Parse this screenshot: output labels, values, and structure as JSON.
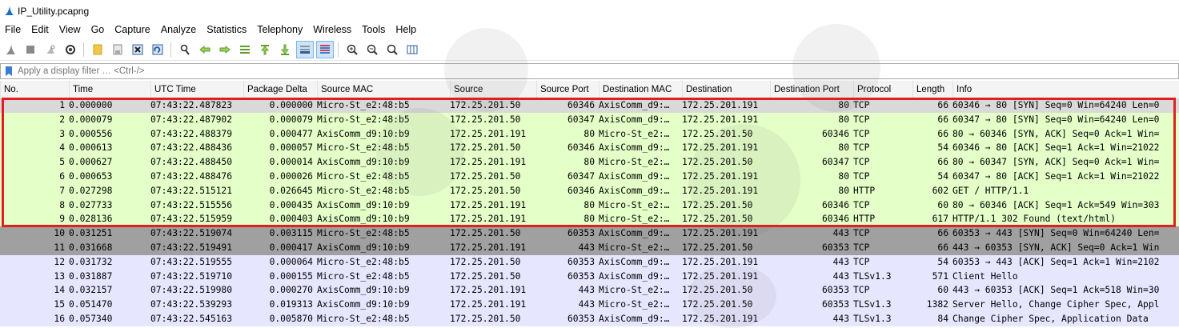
{
  "window": {
    "title": "IP_Utility.pcapng"
  },
  "menu": [
    "File",
    "Edit",
    "View",
    "Go",
    "Capture",
    "Analyze",
    "Statistics",
    "Telephony",
    "Wireless",
    "Tools",
    "Help"
  ],
  "toolbar_icons": [
    "shark-fin-start-icon",
    "stop-icon",
    "restart-icon",
    "capture-options-icon",
    "open-file-icon",
    "save-file-icon",
    "close-file-icon",
    "reload-file-icon",
    "find-packet-icon",
    "go-back-icon",
    "go-forward-icon",
    "go-to-packet-icon",
    "go-first-icon",
    "go-last-icon",
    "autoscroll-icon",
    "colorize-icon",
    "zoom-in-icon",
    "zoom-out-icon",
    "zoom-normal-icon",
    "resize-columns-icon"
  ],
  "filter": {
    "placeholder": "Apply a display filter … <Ctrl-/>"
  },
  "columns": [
    "No.",
    "Time",
    "UTC Time",
    "Package Delta",
    "Source MAC",
    "Source",
    "Source Port",
    "Destination MAC",
    "Destination",
    "Destination Port",
    "Protocol",
    "Length",
    "Info"
  ],
  "colors": {
    "tcp_green": "#e4ffc7",
    "selected_bg": "#d9d9d9",
    "dark_row": "#a0a0a0",
    "tls_lavender": "#e7e6ff",
    "highlight_box": "#e02020"
  },
  "rows": [
    {
      "no": "1",
      "time": "0.000000",
      "utc": "07:43:22.487823",
      "delta": "0.000000",
      "smac": "Micro-St_e2:48:b5",
      "src": "172.25.201.50",
      "sport": "60346",
      "dmac": "AxisComm_d9:…",
      "dst": "172.25.201.191",
      "dport": "80",
      "proto": "TCP",
      "len": "66",
      "info": "60346 → 80 [SYN] Seq=0 Win=64240 Len=0",
      "style": "selected"
    },
    {
      "no": "2",
      "time": "0.000079",
      "utc": "07:43:22.487902",
      "delta": "0.000079",
      "smac": "Micro-St_e2:48:b5",
      "src": "172.25.201.50",
      "sport": "60347",
      "dmac": "AxisComm_d9:…",
      "dst": "172.25.201.191",
      "dport": "80",
      "proto": "TCP",
      "len": "66",
      "info": "60347 → 80 [SYN] Seq=0 Win=64240 Len=0",
      "style": "green"
    },
    {
      "no": "3",
      "time": "0.000556",
      "utc": "07:43:22.488379",
      "delta": "0.000477",
      "smac": "AxisComm_d9:10:b9",
      "src": "172.25.201.191",
      "sport": "80",
      "dmac": "Micro-St_e2:…",
      "dst": "172.25.201.50",
      "dport": "60346",
      "proto": "TCP",
      "len": "66",
      "info": "80 → 60346 [SYN, ACK] Seq=0 Ack=1 Win=",
      "style": "green"
    },
    {
      "no": "4",
      "time": "0.000613",
      "utc": "07:43:22.488436",
      "delta": "0.000057",
      "smac": "Micro-St_e2:48:b5",
      "src": "172.25.201.50",
      "sport": "60346",
      "dmac": "AxisComm_d9:…",
      "dst": "172.25.201.191",
      "dport": "80",
      "proto": "TCP",
      "len": "54",
      "info": "60346 → 80 [ACK] Seq=1 Ack=1 Win=21022",
      "style": "green"
    },
    {
      "no": "5",
      "time": "0.000627",
      "utc": "07:43:22.488450",
      "delta": "0.000014",
      "smac": "AxisComm_d9:10:b9",
      "src": "172.25.201.191",
      "sport": "80",
      "dmac": "Micro-St_e2:…",
      "dst": "172.25.201.50",
      "dport": "60347",
      "proto": "TCP",
      "len": "66",
      "info": "80 → 60347 [SYN, ACK] Seq=0 Ack=1 Win=",
      "style": "green"
    },
    {
      "no": "6",
      "time": "0.000653",
      "utc": "07:43:22.488476",
      "delta": "0.000026",
      "smac": "Micro-St_e2:48:b5",
      "src": "172.25.201.50",
      "sport": "60347",
      "dmac": "AxisComm_d9:…",
      "dst": "172.25.201.191",
      "dport": "80",
      "proto": "TCP",
      "len": "54",
      "info": "60347 → 80 [ACK] Seq=1 Ack=1 Win=21022",
      "style": "green"
    },
    {
      "no": "7",
      "time": "0.027298",
      "utc": "07:43:22.515121",
      "delta": "0.026645",
      "smac": "Micro-St_e2:48:b5",
      "src": "172.25.201.50",
      "sport": "60346",
      "dmac": "AxisComm_d9:…",
      "dst": "172.25.201.191",
      "dport": "80",
      "proto": "HTTP",
      "len": "602",
      "info": "GET / HTTP/1.1",
      "style": "green"
    },
    {
      "no": "8",
      "time": "0.027733",
      "utc": "07:43:22.515556",
      "delta": "0.000435",
      "smac": "AxisComm_d9:10:b9",
      "src": "172.25.201.191",
      "sport": "80",
      "dmac": "Micro-St_e2:…",
      "dst": "172.25.201.50",
      "dport": "60346",
      "proto": "TCP",
      "len": "60",
      "info": "80 → 60346 [ACK] Seq=1 Ack=549 Win=303",
      "style": "green"
    },
    {
      "no": "9",
      "time": "0.028136",
      "utc": "07:43:22.515959",
      "delta": "0.000403",
      "smac": "AxisComm_d9:10:b9",
      "src": "172.25.201.191",
      "sport": "80",
      "dmac": "Micro-St_e2:…",
      "dst": "172.25.201.50",
      "dport": "60346",
      "proto": "HTTP",
      "len": "617",
      "info": "HTTP/1.1 302 Found  (text/html)",
      "style": "green"
    },
    {
      "no": "10",
      "time": "0.031251",
      "utc": "07:43:22.519074",
      "delta": "0.003115",
      "smac": "Micro-St_e2:48:b5",
      "src": "172.25.201.50",
      "sport": "60353",
      "dmac": "AxisComm_d9:…",
      "dst": "172.25.201.191",
      "dport": "443",
      "proto": "TCP",
      "len": "66",
      "info": "60353 → 443 [SYN] Seq=0 Win=64240 Len=",
      "style": "dark"
    },
    {
      "no": "11",
      "time": "0.031668",
      "utc": "07:43:22.519491",
      "delta": "0.000417",
      "smac": "AxisComm_d9:10:b9",
      "src": "172.25.201.191",
      "sport": "443",
      "dmac": "Micro-St_e2:…",
      "dst": "172.25.201.50",
      "dport": "60353",
      "proto": "TCP",
      "len": "66",
      "info": "443 → 60353 [SYN, ACK] Seq=0 Ack=1 Win",
      "style": "dark"
    },
    {
      "no": "12",
      "time": "0.031732",
      "utc": "07:43:22.519555",
      "delta": "0.000064",
      "smac": "Micro-St_e2:48:b5",
      "src": "172.25.201.50",
      "sport": "60353",
      "dmac": "AxisComm_d9:…",
      "dst": "172.25.201.191",
      "dport": "443",
      "proto": "TCP",
      "len": "54",
      "info": "60353 → 443 [ACK] Seq=1 Ack=1 Win=2102",
      "style": "lavender"
    },
    {
      "no": "13",
      "time": "0.031887",
      "utc": "07:43:22.519710",
      "delta": "0.000155",
      "smac": "Micro-St_e2:48:b5",
      "src": "172.25.201.50",
      "sport": "60353",
      "dmac": "AxisComm_d9:…",
      "dst": "172.25.201.191",
      "dport": "443",
      "proto": "TLSv1.3",
      "len": "571",
      "info": "Client Hello",
      "style": "lavender"
    },
    {
      "no": "14",
      "time": "0.032157",
      "utc": "07:43:22.519980",
      "delta": "0.000270",
      "smac": "AxisComm_d9:10:b9",
      "src": "172.25.201.191",
      "sport": "443",
      "dmac": "Micro-St_e2:…",
      "dst": "172.25.201.50",
      "dport": "60353",
      "proto": "TCP",
      "len": "60",
      "info": "443 → 60353 [ACK] Seq=1 Ack=518 Win=30",
      "style": "lavender"
    },
    {
      "no": "15",
      "time": "0.051470",
      "utc": "07:43:22.539293",
      "delta": "0.019313",
      "smac": "AxisComm_d9:10:b9",
      "src": "172.25.201.191",
      "sport": "443",
      "dmac": "Micro-St_e2:…",
      "dst": "172.25.201.50",
      "dport": "60353",
      "proto": "TLSv1.3",
      "len": "1382",
      "info": "Server Hello, Change Cipher Spec, Appl",
      "style": "lavender"
    },
    {
      "no": "16",
      "time": "0.057340",
      "utc": "07:43:22.545163",
      "delta": "0.005870",
      "smac": "Micro-St_e2:48:b5",
      "src": "172.25.201.50",
      "sport": "60353",
      "dmac": "AxisComm_d9:…",
      "dst": "172.25.201.191",
      "dport": "443",
      "proto": "TLSv1.3",
      "len": "84",
      "info": "Change Cipher Spec, Application Data",
      "style": "lavender"
    }
  ]
}
